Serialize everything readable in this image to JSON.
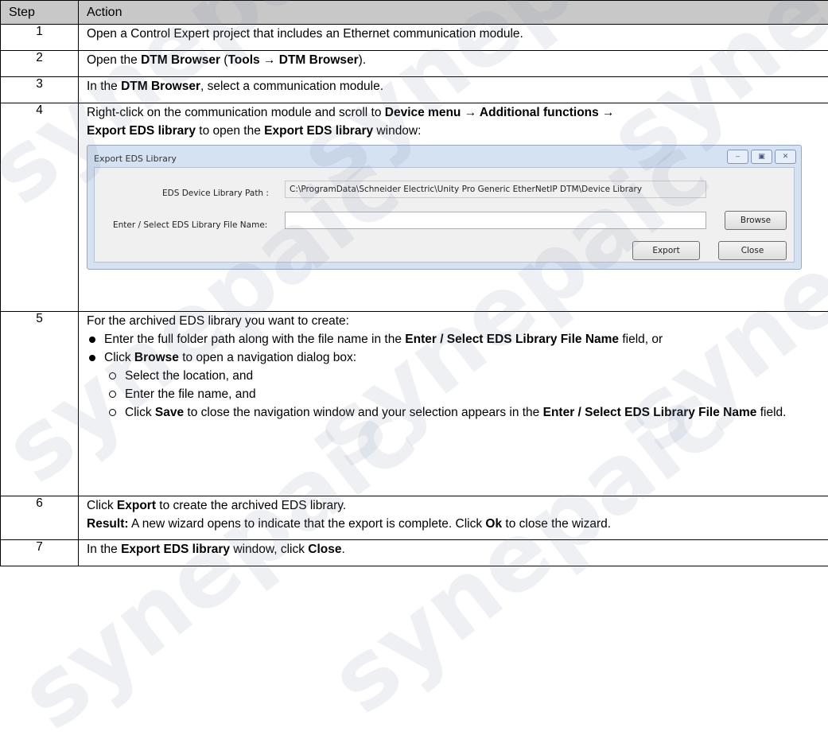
{
  "headers": {
    "step": "Step",
    "action": "Action"
  },
  "steps": {
    "s1": {
      "num": "1",
      "text": "Open a Control Expert project that includes an Ethernet communication module."
    },
    "s2": {
      "num": "2",
      "a": "Open the ",
      "b1": "DTM Browser",
      "c": " (",
      "b2": "Tools → DTM Browser",
      "d": ")."
    },
    "s3": {
      "num": "3",
      "a": "In the ",
      "b1": "DTM Browser",
      "c": ", select a communication module."
    },
    "s4": {
      "num": "4",
      "a": "Right-click on the communication module and scroll to ",
      "b1": "Device menu → Additional functions →",
      "b2": "Export EDS library",
      "c": " to open the ",
      "b3": "Export EDS library",
      "d": " window:"
    },
    "s5": {
      "num": "5",
      "intro": "For the archived EDS library you want to create:",
      "bullet1": {
        "a": "Enter the full folder path along with the file name in the ",
        "b1": "Enter / Select EDS Library File Name",
        "c": " field, or"
      },
      "bullet2": {
        "a": "Click ",
        "b1": "Browse",
        "c": " to open a navigation dialog box:"
      },
      "sub1": "Select the location, and",
      "sub2": "Enter the file name, and",
      "sub3": {
        "a": "Click ",
        "b1": "Save",
        "c": " to close the navigation window and your selection appears in the ",
        "b2": "Enter / Select EDS Library File Name",
        "d": " field."
      }
    },
    "s6": {
      "num": "6",
      "a": "Click ",
      "b1": "Export",
      "c": " to create the archived EDS library.",
      "r_label": "Result:",
      "r_a": " A new wizard opens to indicate that the export is complete. Click ",
      "r_b": "Ok",
      "r_c": " to close the wizard."
    },
    "s7": {
      "num": "7",
      "a": "In the ",
      "b1": "Export EDS library",
      "c": " window, click ",
      "b2": "Close",
      "d": "."
    }
  },
  "dialog": {
    "title": "Export EDS Library",
    "path_label": "EDS Device Library Path :",
    "path_value": "C:\\ProgramData\\Schneider Electric\\Unity Pro Generic EtherNetIP DTM\\Device Library",
    "file_label": "Enter / Select EDS Library File Name:",
    "file_value": "",
    "browse_label": "Browse",
    "export_label": "Export",
    "close_label": "Close",
    "min_glyph": "‒",
    "max_glyph": "▣",
    "close_glyph": "✕"
  },
  "watermark": "synepaic"
}
